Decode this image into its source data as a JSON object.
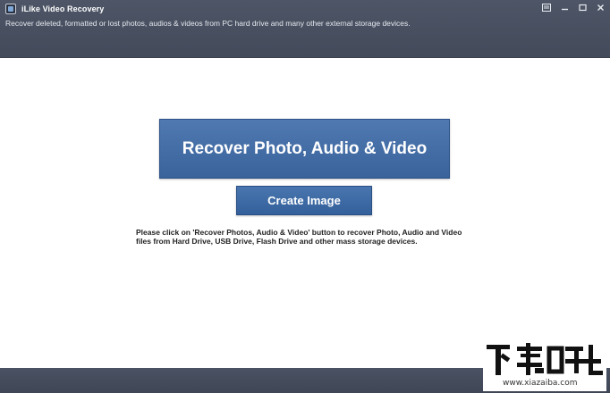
{
  "window": {
    "title": "iLike Video Recovery",
    "subtitle": "Recover deleted, formatted or lost photos, audios & videos from PC hard drive and many other external storage devices.",
    "controls": [
      "menu-icon",
      "minimize-icon",
      "maximize-icon",
      "close-icon"
    ]
  },
  "main": {
    "recover_button_label": "Recover Photo, Audio & Video",
    "create_image_button_label": "Create Image",
    "help_line_1": "Please click on 'Recover Photos, Audio & Video' button to recover Photo, Audio and Video",
    "help_line_2": "files from Hard Drive, USB Drive, Flash Drive and other mass storage devices."
  },
  "watermark": {
    "url": "www.xiazaiba.com"
  },
  "colors": {
    "titlebar": "#4a5568",
    "button": "#3f6aa3",
    "footer": "#454c5c"
  }
}
